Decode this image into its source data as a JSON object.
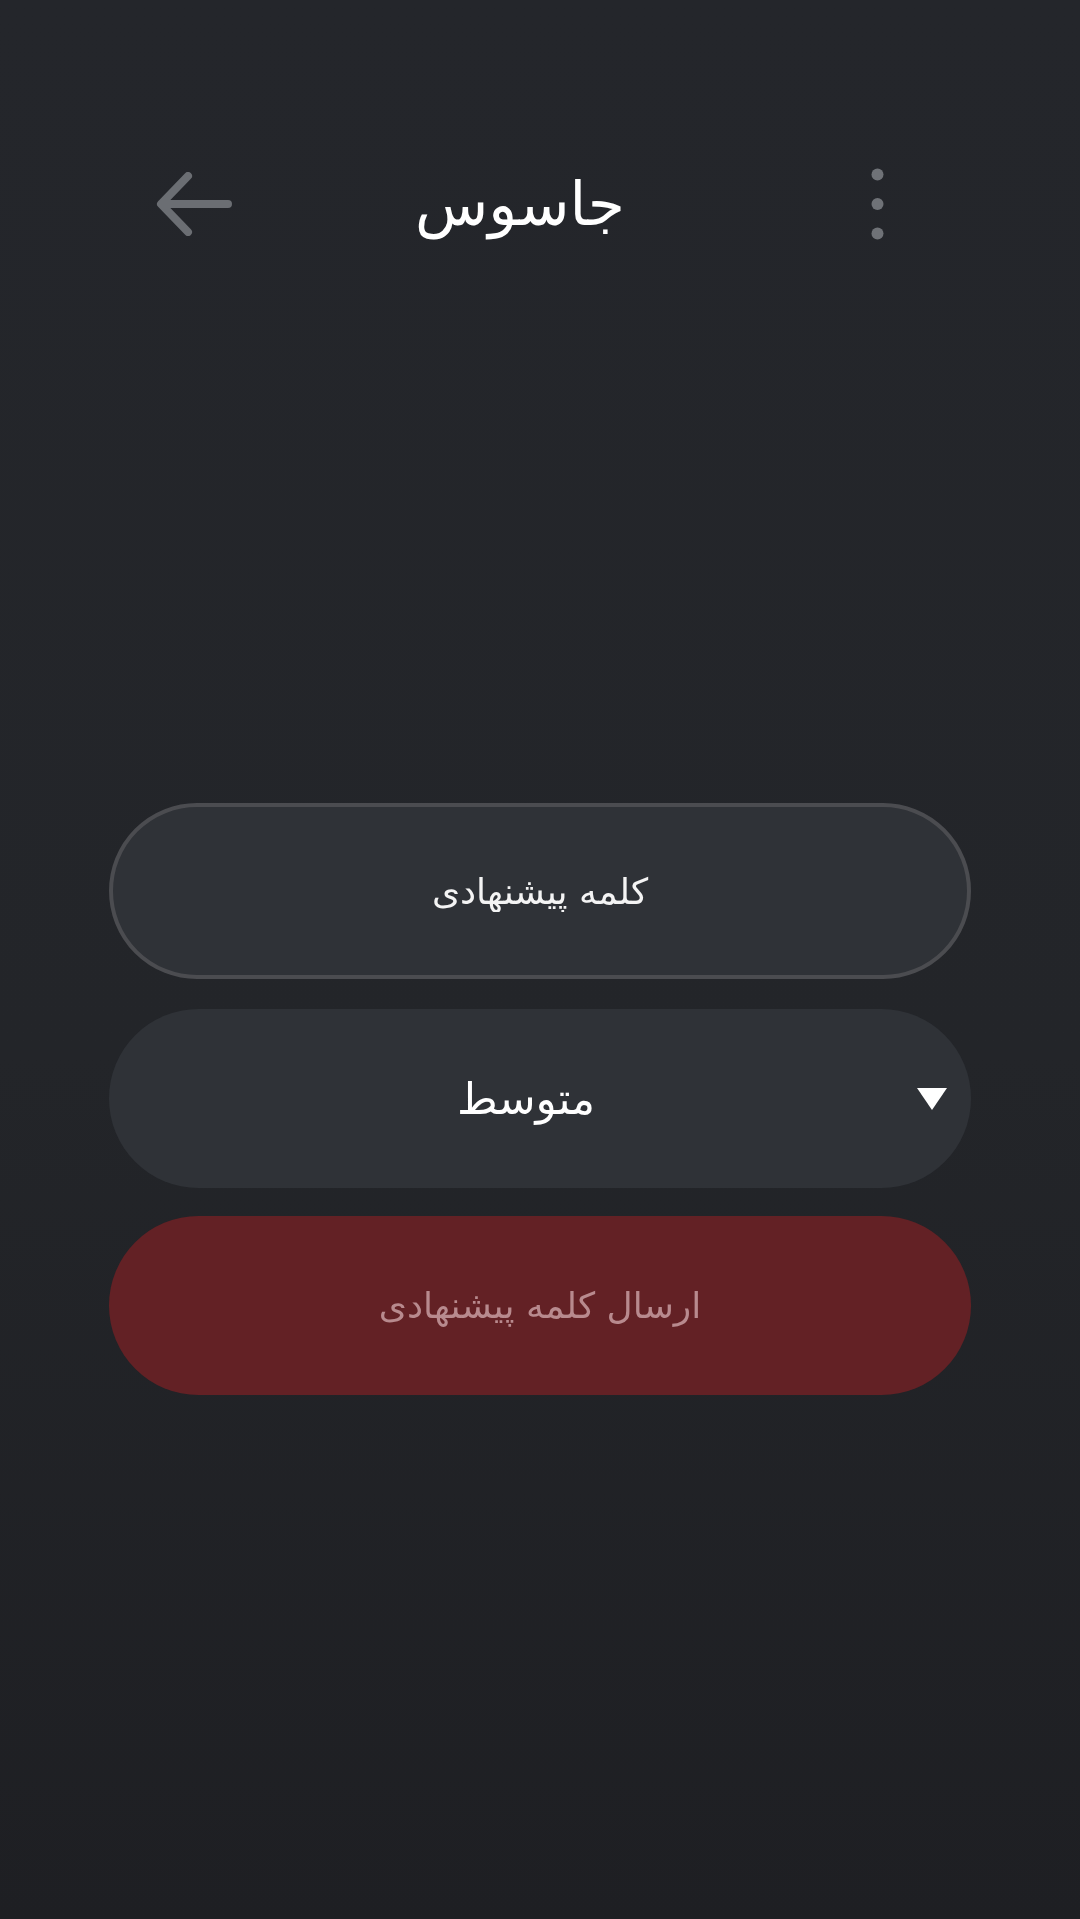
{
  "header": {
    "logo": "جاسوس"
  },
  "form": {
    "word_field": {
      "placeholder": "کلمه پیشنهادی"
    },
    "difficulty": {
      "value": "متوسط"
    },
    "submit": {
      "label": "ارسال کلمه پیشنهادی",
      "disabled": true
    }
  }
}
